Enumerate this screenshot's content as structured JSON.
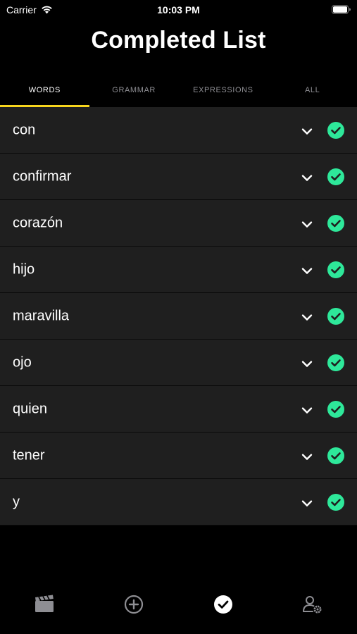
{
  "status_bar": {
    "carrier": "Carrier",
    "time": "10:03 PM"
  },
  "header": {
    "title": "Completed List"
  },
  "tabs": [
    {
      "label": "WORDS",
      "active": true
    },
    {
      "label": "GRAMMAR",
      "active": false
    },
    {
      "label": "EXPRESSIONS",
      "active": false
    },
    {
      "label": "ALL",
      "active": false
    }
  ],
  "list": {
    "items": [
      {
        "label": "con",
        "completed": true
      },
      {
        "label": "confirmar",
        "completed": true
      },
      {
        "label": "corazón",
        "completed": true
      },
      {
        "label": "hijo",
        "completed": true
      },
      {
        "label": "maravilla",
        "completed": true
      },
      {
        "label": "ojo",
        "completed": true
      },
      {
        "label": "quien",
        "completed": true
      },
      {
        "label": "tener",
        "completed": true
      },
      {
        "label": "y",
        "completed": true
      }
    ]
  },
  "bottom_nav": {
    "items": [
      {
        "icon": "clapperboard-icon",
        "active": false
      },
      {
        "icon": "add-circle-icon",
        "active": false
      },
      {
        "icon": "check-circle-icon",
        "active": true
      },
      {
        "icon": "user-settings-icon",
        "active": false
      }
    ]
  },
  "colors": {
    "background": "#000000",
    "row_background": "#1f1f1f",
    "accent_yellow": "#f7d51d",
    "check_green": "#2ee89a",
    "inactive_gray": "#8e8e93"
  }
}
